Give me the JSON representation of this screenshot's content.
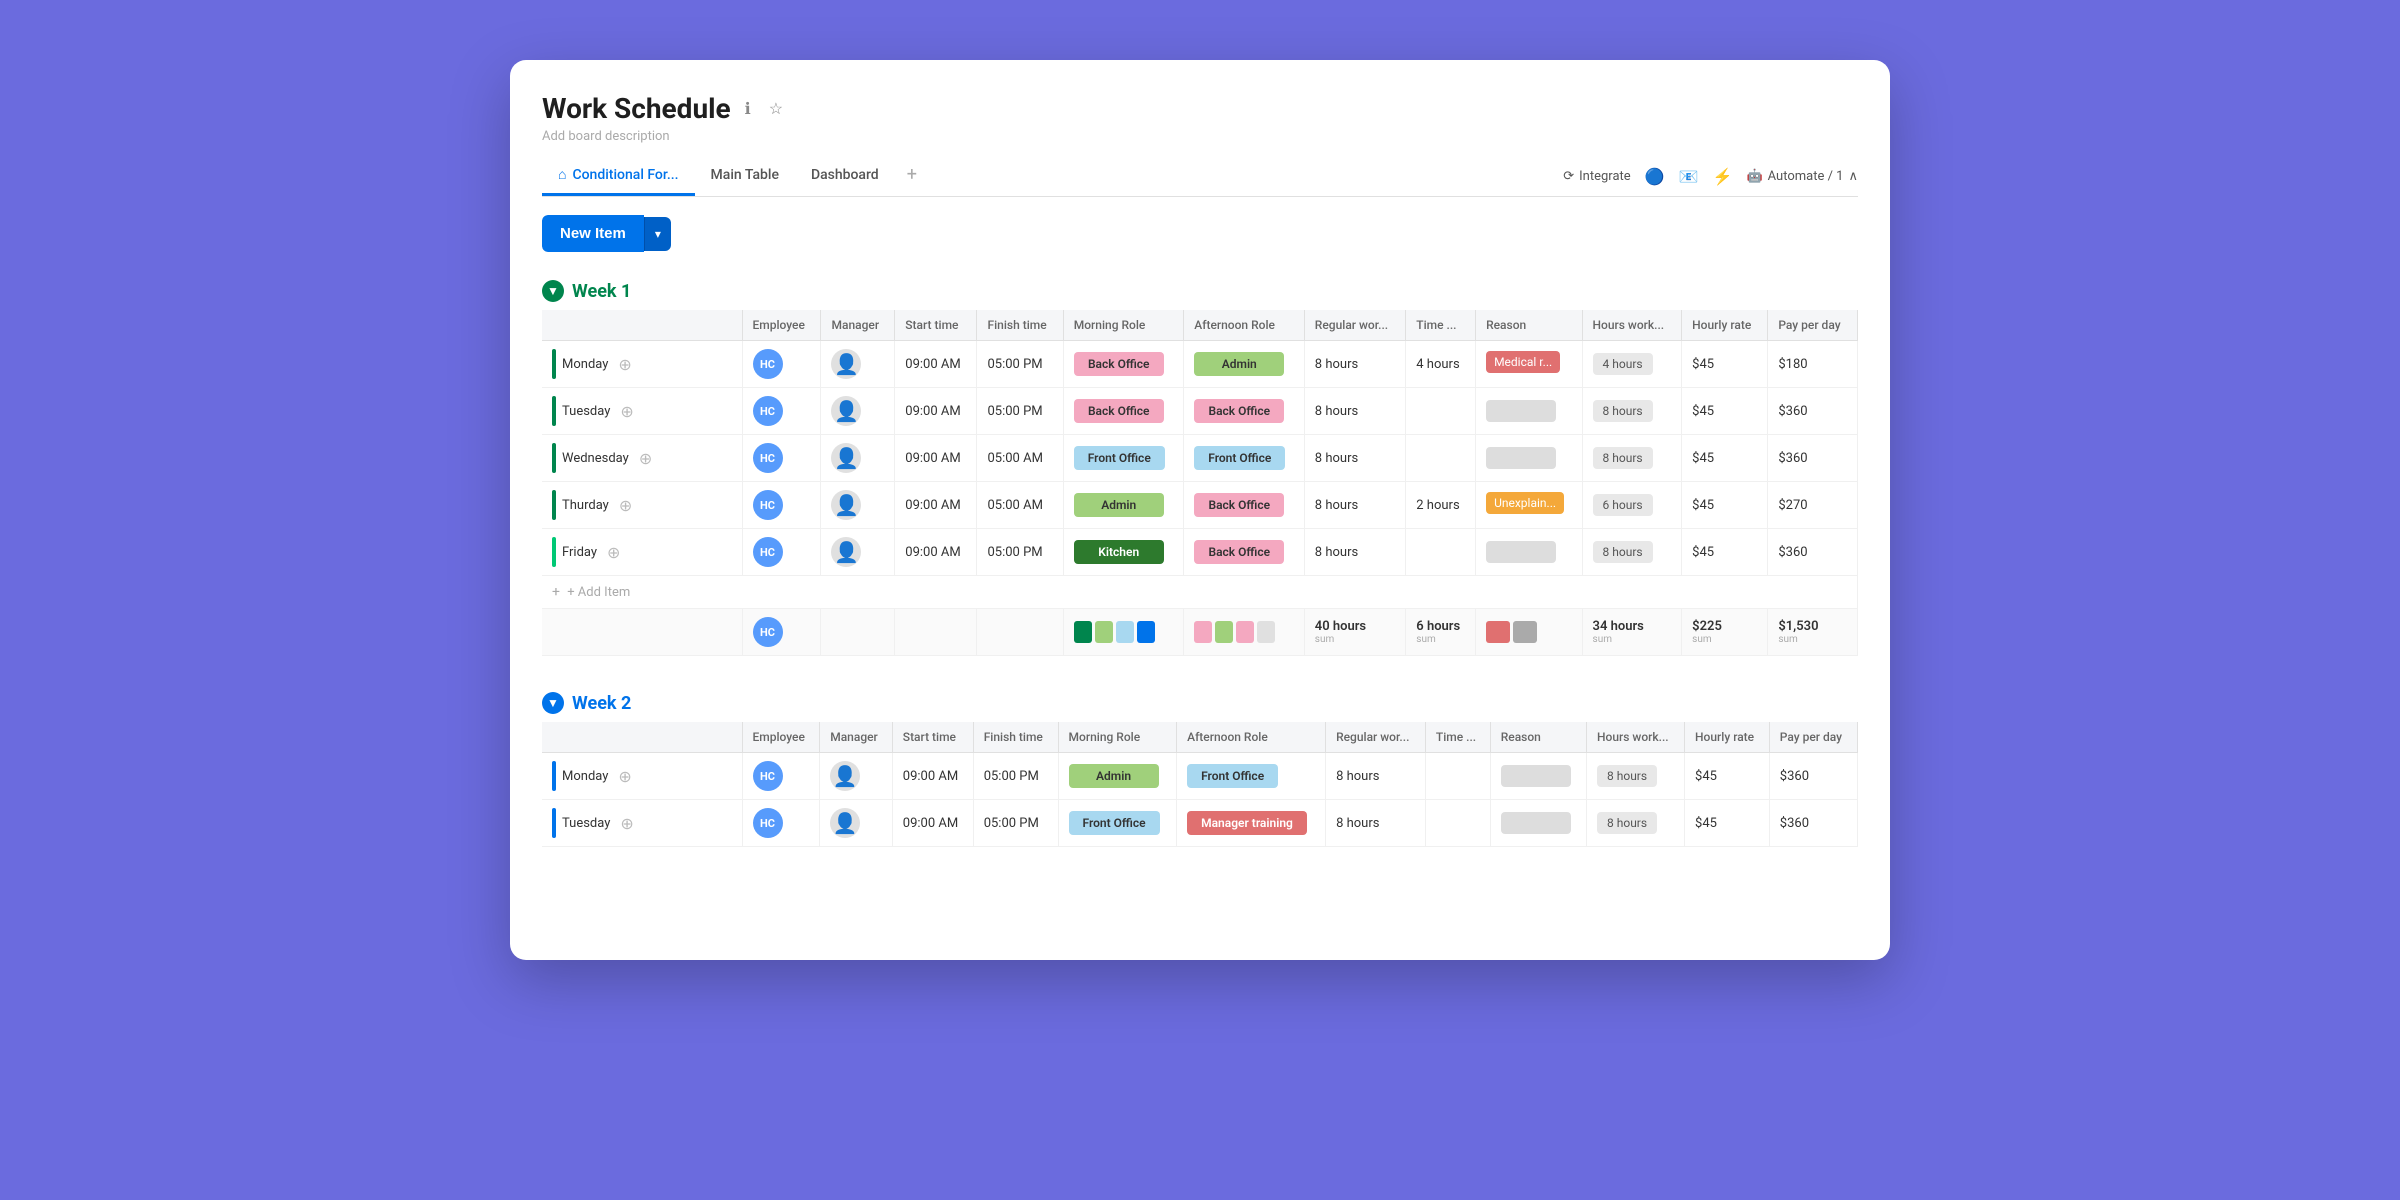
{
  "app": {
    "background": "#6b6bde",
    "title": "Work Schedule",
    "description": "Add board description",
    "info_icon": "ℹ",
    "star_icon": "☆"
  },
  "tabs": {
    "items": [
      {
        "label": "Conditional For...",
        "icon": "⌂",
        "active": true
      },
      {
        "label": "Main Table",
        "icon": "",
        "active": false
      },
      {
        "label": "Dashboard",
        "icon": "",
        "active": false
      }
    ],
    "add_label": "+",
    "integrate_label": "Integrate",
    "automate_label": "Automate / 1"
  },
  "toolbar": {
    "new_item_label": "New Item",
    "caret": "▾"
  },
  "week1": {
    "title": "Week 1",
    "color": "green",
    "columns": [
      {
        "key": "day",
        "label": ""
      },
      {
        "key": "employee",
        "label": "Employee"
      },
      {
        "key": "manager",
        "label": "Manager"
      },
      {
        "key": "start",
        "label": "Start time"
      },
      {
        "key": "finish",
        "label": "Finish time"
      },
      {
        "key": "morning_role",
        "label": "Morning Role"
      },
      {
        "key": "afternoon_role",
        "label": "Afternoon Role"
      },
      {
        "key": "regular_work",
        "label": "Regular wor..."
      },
      {
        "key": "time_off",
        "label": "Time ..."
      },
      {
        "key": "reason",
        "label": "Reason"
      },
      {
        "key": "hours_worked",
        "label": "Hours work..."
      },
      {
        "key": "hourly_rate",
        "label": "Hourly rate"
      },
      {
        "key": "pay_per_day",
        "label": "Pay per day"
      }
    ],
    "rows": [
      {
        "day": "Monday",
        "employee": "HC",
        "manager": "person",
        "start": "09:00 AM",
        "finish": "05:00 PM",
        "morning_role": "Back Office",
        "morning_role_class": "role-back-office",
        "afternoon_role": "Admin",
        "afternoon_role_class": "role-admin",
        "regular_work": "8 hours",
        "time_off": "4 hours",
        "reason": "Medical r...",
        "reason_class": "reason-medical",
        "hours_worked": "4 hours",
        "hourly_rate": "$45",
        "pay_per_day": "$180",
        "bar_color": "color-green"
      },
      {
        "day": "Tuesday",
        "employee": "HC",
        "manager": "person",
        "start": "09:00 AM",
        "finish": "05:00 PM",
        "morning_role": "Back Office",
        "morning_role_class": "role-back-office",
        "afternoon_role": "Back Office",
        "afternoon_role_class": "role-back-office",
        "regular_work": "8 hours",
        "time_off": "",
        "reason": "",
        "reason_class": "",
        "hours_worked": "8 hours",
        "hourly_rate": "$45",
        "pay_per_day": "$360",
        "bar_color": "color-green"
      },
      {
        "day": "Wednesday",
        "employee": "HC",
        "manager": "person",
        "start": "09:00 AM",
        "finish": "05:00 AM",
        "morning_role": "Front Office",
        "morning_role_class": "role-front-office",
        "afternoon_role": "Front Office",
        "afternoon_role_class": "role-front-office",
        "regular_work": "8 hours",
        "time_off": "",
        "reason": "",
        "reason_class": "",
        "hours_worked": "8 hours",
        "hourly_rate": "$45",
        "pay_per_day": "$360",
        "bar_color": "color-green"
      },
      {
        "day": "Thurday",
        "employee": "HC",
        "manager": "person",
        "start": "09:00 AM",
        "finish": "05:00 AM",
        "morning_role": "Admin",
        "morning_role_class": "role-admin",
        "afternoon_role": "Back Office",
        "afternoon_role_class": "role-back-office",
        "regular_work": "8 hours",
        "time_off": "2 hours",
        "reason": "Unexplain...",
        "reason_class": "reason-unexplained",
        "hours_worked": "6 hours",
        "hourly_rate": "$45",
        "pay_per_day": "$270",
        "bar_color": "color-green"
      },
      {
        "day": "Friday",
        "employee": "HC",
        "manager": "person",
        "start": "09:00 AM",
        "finish": "05:00 PM",
        "morning_role": "Kitchen",
        "morning_role_class": "role-kitchen",
        "afternoon_role": "Back Office",
        "afternoon_role_class": "role-back-office",
        "regular_work": "8 hours",
        "time_off": "",
        "reason": "",
        "reason_class": "",
        "hours_worked": "8 hours",
        "hourly_rate": "$45",
        "pay_per_day": "$360",
        "bar_color": "color-teal"
      }
    ],
    "summary": {
      "employee": "HC",
      "morning_colors": [
        "#00854d",
        "#a0d07b",
        "#a8d8f0",
        "#0073ea"
      ],
      "afternoon_colors": [
        "#f4a8c0",
        "#a0d07b",
        "#f4a8c0",
        "#e0e0e0"
      ],
      "regular_work": "40 hours",
      "time_off": "6 hours",
      "reason_colors": [
        "#e07070",
        "#aaa"
      ],
      "hours_worked": "34 hours",
      "hourly_rate": "$225",
      "pay_per_day": "$1,530",
      "sum_label": "sum"
    },
    "add_item_label": "+ Add Item"
  },
  "week2": {
    "title": "Week 2",
    "color": "blue",
    "rows": [
      {
        "day": "Monday",
        "employee": "HC",
        "manager": "person",
        "start": "09:00 AM",
        "finish": "05:00 PM",
        "morning_role": "Admin",
        "morning_role_class": "role-admin",
        "afternoon_role": "Front Office",
        "afternoon_role_class": "role-front-office",
        "regular_work": "8 hours",
        "time_off": "",
        "reason": "",
        "reason_class": "",
        "hours_worked": "8 hours",
        "hourly_rate": "$45",
        "pay_per_day": "$360",
        "bar_color": "color-blue"
      },
      {
        "day": "Tuesday",
        "employee": "HC",
        "manager": "person",
        "start": "09:00 AM",
        "finish": "05:00 PM",
        "morning_role": "Front Office",
        "morning_role_class": "role-front-office",
        "afternoon_role": "Manager training",
        "afternoon_role_class": "role-manager-training",
        "regular_work": "8 hours",
        "time_off": "",
        "reason": "",
        "reason_class": "",
        "hours_worked": "8 hours",
        "hourly_rate": "$45",
        "pay_per_day": "$360",
        "bar_color": "color-blue"
      }
    ]
  }
}
